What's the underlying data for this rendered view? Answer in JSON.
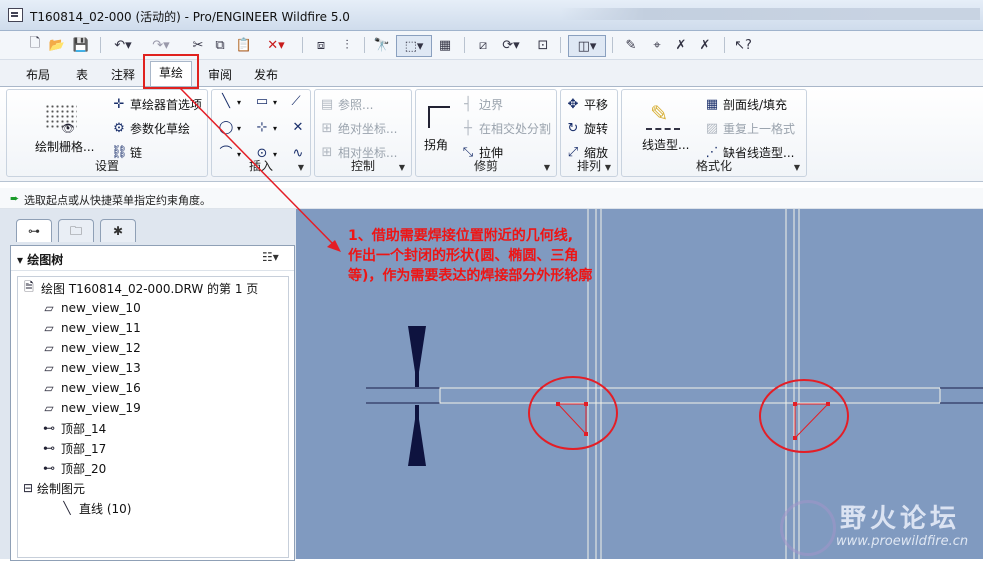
{
  "window": {
    "title": "T160814_02-000 (活动的) - Pro/ENGINEER Wildfire 5.0"
  },
  "quick_access": {
    "icons": [
      "new-icon",
      "open-icon",
      "save-icon",
      "undo-icon",
      "redo-icon",
      "cut-icon",
      "copy-icon",
      "paste-icon",
      "delete-icon",
      "layers-icon",
      "tree-icon",
      "find-icon",
      "select-box-icon",
      "info-icon",
      "repaint-icon",
      "refresh-icon",
      "zoom-icon",
      "view-icon",
      "note-icon",
      "dimension-icon",
      "datum-off-icon",
      "axis-off-icon",
      "whats-this-icon"
    ]
  },
  "tabs": [
    {
      "label": "布局"
    },
    {
      "label": "表"
    },
    {
      "label": "注释"
    },
    {
      "label": "草绘",
      "active": true
    },
    {
      "label": "审阅"
    },
    {
      "label": "发布"
    }
  ],
  "ribbon": {
    "settings": {
      "label": "设置",
      "grid": "绘制栅格...",
      "prefs": "草绘器首选项",
      "param": "参数化草绘",
      "chain": "链"
    },
    "insert": {
      "label": "插入"
    },
    "control": {
      "label": "控制",
      "ref": "参照...",
      "abs": "绝对坐标...",
      "rel": "相对坐标..."
    },
    "trim": {
      "label": "修剪",
      "corner": "拐角",
      "boundary": "边界",
      "split": "在相交处分割",
      "stretch": "拉伸"
    },
    "arrange": {
      "label": "排列",
      "move": "平移",
      "rotate": "旋转",
      "scale": "缩放"
    },
    "format": {
      "label": "格式化",
      "linestyle": "线造型...",
      "hatch": "剖面线/填充",
      "repeat": "重复上一格式",
      "default_line": "缺省线造型..."
    }
  },
  "status": {
    "message": "选取起点或从快捷菜单指定约束角度。"
  },
  "tree": {
    "header": "绘图树",
    "root": "绘图 T160814_02-000.DRW 的第 1 页",
    "items": [
      {
        "label": "new_view_10",
        "icon": "view-icon"
      },
      {
        "label": "new_view_11",
        "icon": "view-icon"
      },
      {
        "label": "new_view_12",
        "icon": "view-icon"
      },
      {
        "label": "new_view_13",
        "icon": "view-icon"
      },
      {
        "label": "new_view_16",
        "icon": "view-icon"
      },
      {
        "label": "new_view_19",
        "icon": "view-icon"
      },
      {
        "label": "顶部_14",
        "icon": "projection-icon"
      },
      {
        "label": "顶部_17",
        "icon": "projection-icon"
      },
      {
        "label": "顶部_20",
        "icon": "projection-icon"
      }
    ],
    "sketched": "绘制图元",
    "line": "直线 (10)"
  },
  "annotation": {
    "lines": [
      "1、借助需要焊接位置附近的几何线,",
      "作出一个封闭的形状(圆、椭圆、三角",
      "等)，作为需要表达的焊接部分外形轮廓"
    ]
  },
  "watermark": {
    "name": "野火论坛",
    "url": "www.proewildfire.cn"
  },
  "colors": {
    "canvas": "#809ac0",
    "annotation": "#ee1515",
    "geometry": "#f2f2e8"
  }
}
